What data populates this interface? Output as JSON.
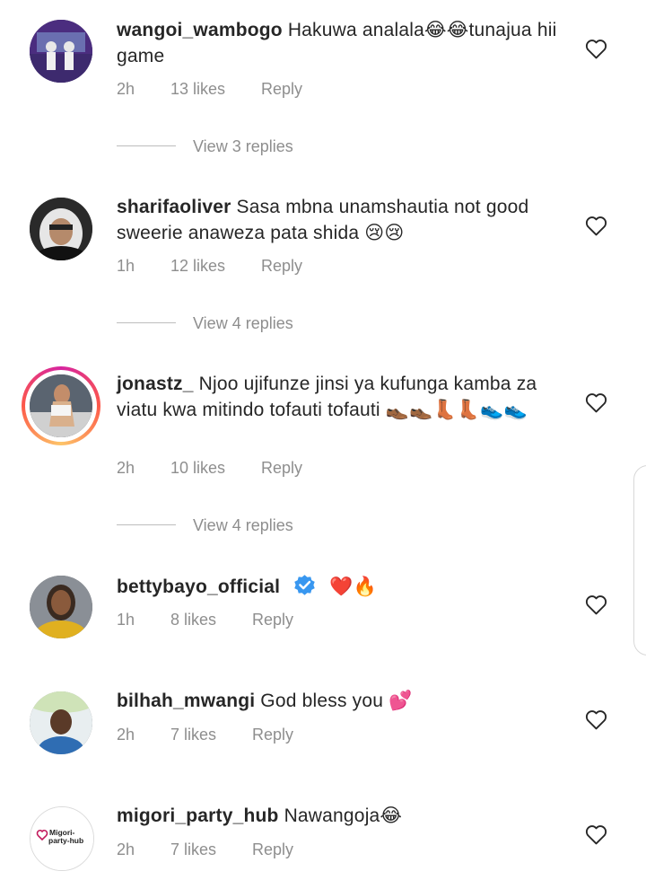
{
  "comments": [
    {
      "username": "wangoi_wambogo",
      "text": "Hakuwa analala😂😂tunajua hii game",
      "time": "2h",
      "likes": "13 likes",
      "reply": "Reply",
      "view_replies": "View 3 replies"
    },
    {
      "username": "sharifaoliver",
      "text": "Sasa mbna unamshautia  not good sweerie anaweza pata shida 😢😢",
      "time": "1h",
      "likes": "12 likes",
      "reply": "Reply",
      "view_replies": "View 4 replies"
    },
    {
      "username": "jonastz_",
      "text": "Njoo ujifunze jinsi ya kufunga kamba za viatu kwa mitindo tofauti tofauti 👞👞👢👢👟👟",
      "time": "2h",
      "likes": "10 likes",
      "reply": "Reply",
      "view_replies": "View 4 replies"
    },
    {
      "username": "bettybayo_official",
      "text": "❤️🔥",
      "time": "1h",
      "likes": "8 likes",
      "reply": "Reply"
    },
    {
      "username": "bilhah_mwangi",
      "text": "God bless you 💕",
      "time": "2h",
      "likes": "7 likes",
      "reply": "Reply"
    },
    {
      "username": "migori_party_hub",
      "text": "Nawangoja😂",
      "time": "2h",
      "likes": "7 likes",
      "reply": "Reply"
    }
  ],
  "migori_logo_text": "Migori-party-hub",
  "colors": {
    "secondary_text": "#8e8e8e",
    "primary_text": "#262626",
    "verified": "#3897f0",
    "story_ring": "#d6249f"
  },
  "icons": {
    "like": "heart-outline-icon",
    "verified": "verified-badge-icon"
  }
}
